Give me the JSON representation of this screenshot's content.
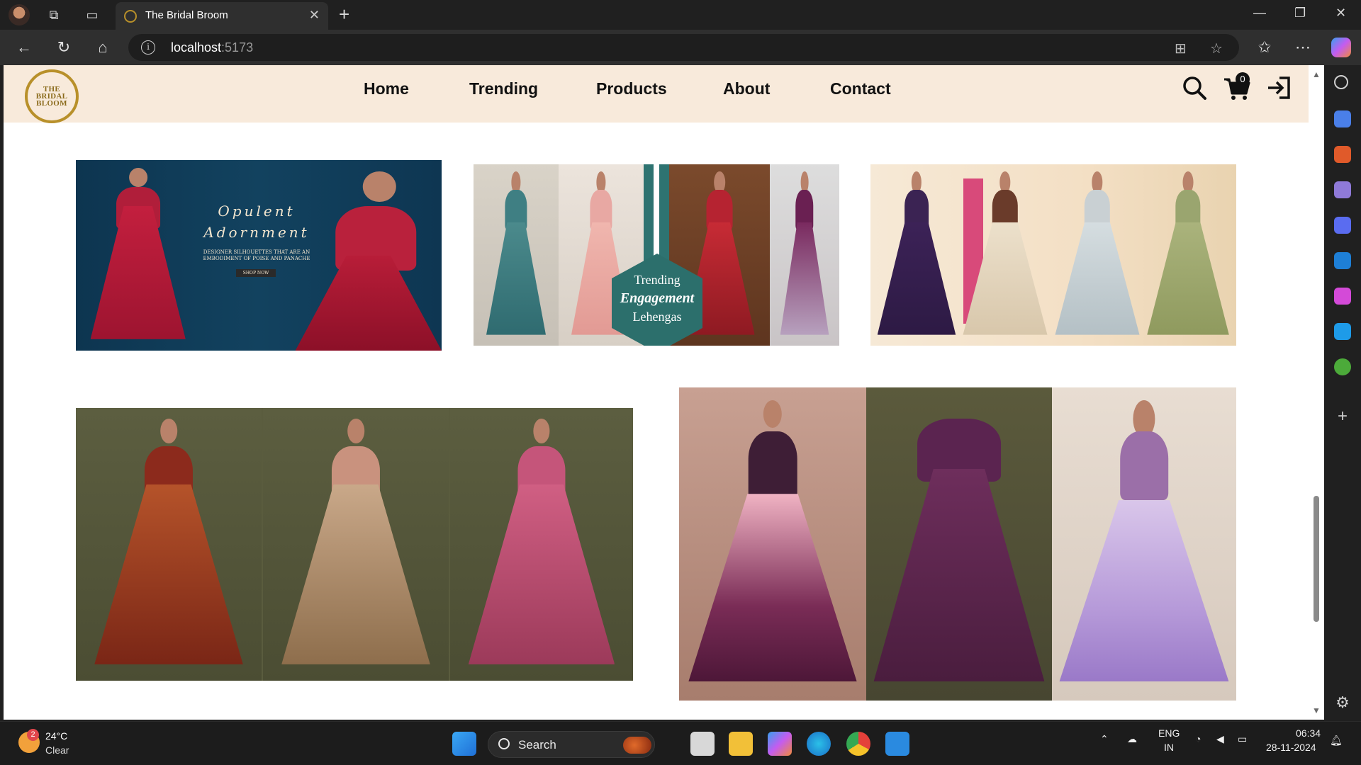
{
  "browser": {
    "tab_title": "The Bridal Broom",
    "url_host": "localhost",
    "url_port": ":5173"
  },
  "site": {
    "logo_lines": [
      "THE",
      "BRIDAL",
      "BLOOM"
    ],
    "nav": [
      "Home",
      "Trending",
      "Products",
      "About",
      "Contact"
    ],
    "cart_count": "0"
  },
  "banners": {
    "opulent_title_1": "Opulent",
    "opulent_title_2": "Adornment",
    "opulent_sub": "DESIGNER SILHOUETTES THAT ARE AN EMBODIMENT OF POISE AND PANACHE",
    "opulent_cta": "SHOP NOW",
    "engagement_line1": "Trending",
    "engagement_line2": "Engagement",
    "engagement_line3": "Lehengas"
  },
  "taskbar": {
    "weather_badge": "2",
    "temperature": "24°C",
    "condition": "Clear",
    "search_label": "Search",
    "lang_1": "ENG",
    "lang_2": "IN",
    "time": "06:34",
    "date": "28-11-2024"
  },
  "icons": [
    "search-icon",
    "cart-icon",
    "login-icon",
    "back-icon",
    "refresh-icon",
    "home-icon",
    "info-icon",
    "star-icon",
    "settings-icon"
  ]
}
